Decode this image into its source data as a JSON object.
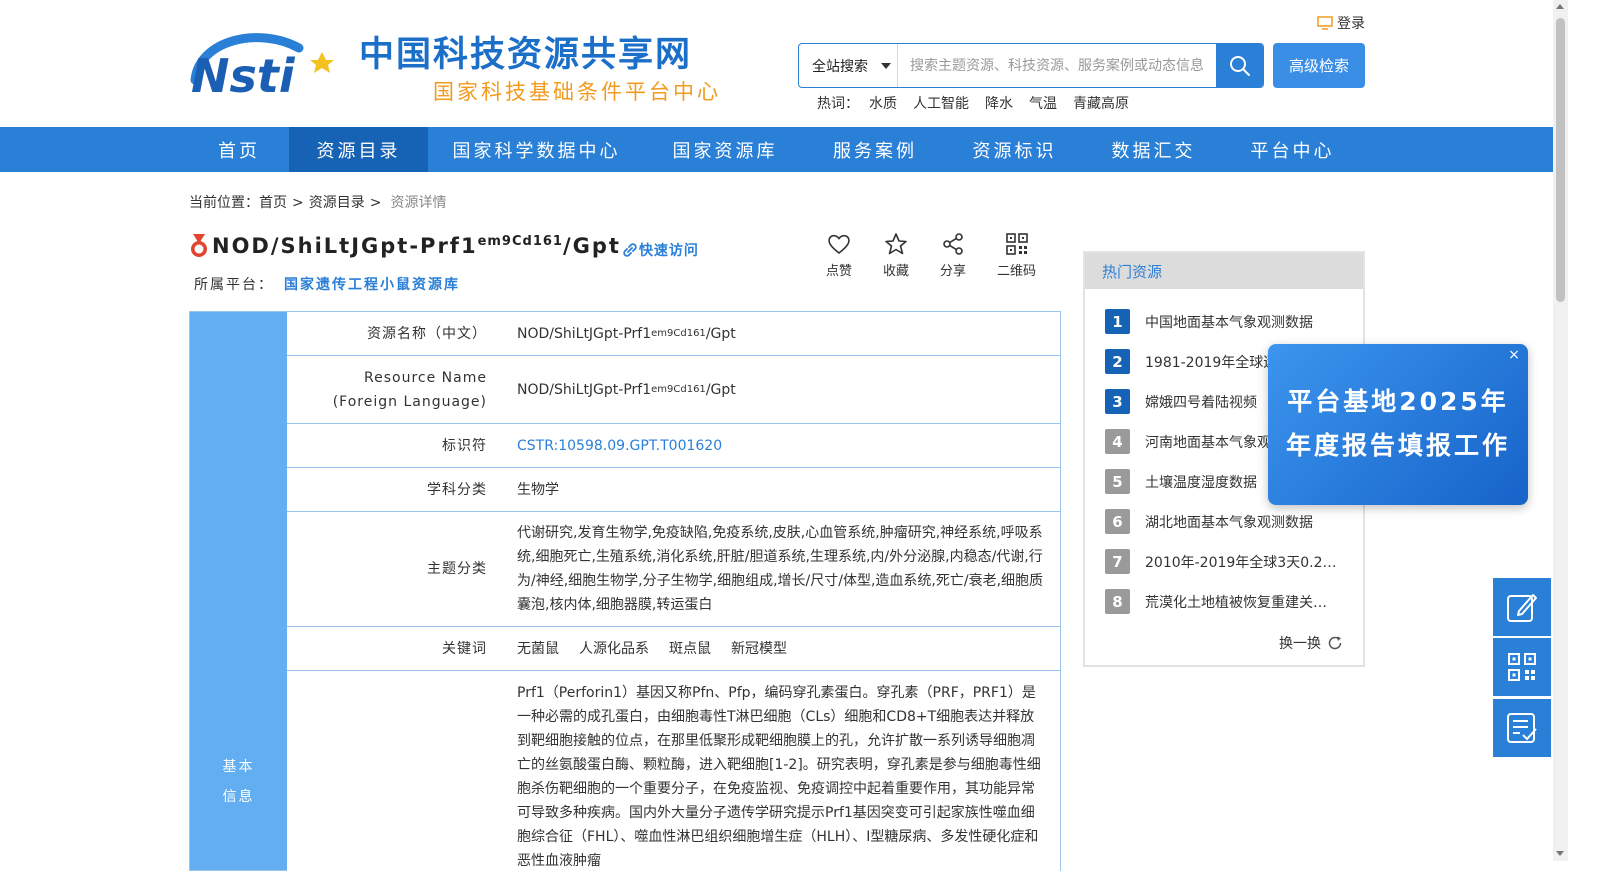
{
  "header": {
    "site_title": "中国科技资源共享网",
    "site_subtitle": "国家科技基础条件平台中心",
    "login": "登录",
    "search_scope": "全站搜索",
    "search_placeholder": "搜索主题资源、科技资源、服务案例或动态信息",
    "advanced_search": "高级检索",
    "hot_label": "热词：",
    "hot_words": [
      "水质",
      "人工智能",
      "降水",
      "气温",
      "青藏高原"
    ]
  },
  "nav": [
    "首页",
    "资源目录",
    "国家科学数据中心",
    "国家资源库",
    "服务案例",
    "资源标识",
    "数据汇交",
    "平台中心"
  ],
  "breadcrumb": {
    "label": "当前位置：",
    "home": "首页",
    "catalog": "资源目录",
    "current": "资源详情",
    "sep": ">"
  },
  "resource": {
    "name_pre": "NOD/ShiLtJGpt-Prf1",
    "name_sup": "em9Cd161",
    "name_post": "/Gpt",
    "quick_access": "快速访问",
    "platform_label": "所属平台：",
    "platform_value": "国家遗传工程小鼠资源库"
  },
  "actions": [
    "点赞",
    "收藏",
    "分享",
    "二维码"
  ],
  "info": {
    "side_label_1": "基本",
    "side_label_2": "信息",
    "rows": {
      "name_cn": {
        "k": "资源名称（中文）",
        "pre": "NOD/ShiLtJGpt-Prf1",
        "sup": "em9Cd161",
        "post": "/Gpt"
      },
      "name_en": {
        "k1": "Resource Name",
        "k2": "(Foreign Language)",
        "pre": "NOD/ShiLtJGpt-Prf1",
        "sup": "em9Cd161",
        "post": "/Gpt"
      },
      "identifier": {
        "k": "标识符",
        "v": "CSTR:10598.09.GPT.T001620"
      },
      "subject": {
        "k": "学科分类",
        "v": "生物学"
      },
      "topic": {
        "k": "主题分类",
        "v": "代谢研究,发育生物学,免疫缺陷,免疫系统,皮肤,心血管系统,肿瘤研究,神经系统,呼吸系统,细胞死亡,生殖系统,消化系统,肝脏/胆道系统,生理系统,内/外分泌腺,内稳态/代谢,行为/神经,细胞生物学,分子生物学,细胞组成,增长/尺寸/体型,造血系统,死亡/衰老,细胞质囊泡,核内体,细胞器膜,转运蛋白"
      },
      "keywords": {
        "k": "关键词",
        "v": [
          "无菌鼠",
          "人源化品系",
          "斑点鼠",
          "新冠模型"
        ]
      },
      "description": {
        "v": "Prf1（Perforin1）基因又称Pfn、Pfp，编码穿孔素蛋白。穿孔素（PRF，PRF1）是一种必需的成孔蛋白，由细胞毒性T淋巴细胞（CLs）细胞和CD8+T细胞表达并释放到靶细胞接触的位点，在那里低聚形成靶细胞膜上的孔，允许扩散一系列诱导细胞凋亡的丝氨酸蛋白酶、颗粒酶，进入靶细胞[1-2]。研究表明，穿孔素是参与细胞毒性细胞杀伤靶细胞的一个重要分子，在免疫监视、免疫调控中起着重要作用，其功能异常可导致多种疾病。国内外大量分子遗传学研究提示Prf1基因突变可引起家族性噬血细胞综合征（FHL）、噬血性淋巴组织细胞增生症（HLH）、I型糖尿病、多发性硬化症和恶性血液肿瘤"
      }
    }
  },
  "hot": {
    "title": "热门资源",
    "items": [
      "中国地面基本气象观测数据",
      "1981-2019年全球逐日",
      "嫦娥四号着陆视频",
      "河南地面基本气象观测数据",
      "土壤温度湿度数据",
      "湖北地面基本气象观测数据",
      "2010年-2019年全球3天0.25°…",
      "荒漠化土地植被恢复重建关键…"
    ],
    "ranks": [
      "1",
      "2",
      "3",
      "4",
      "5",
      "6",
      "7",
      "8"
    ],
    "refresh": "换一换"
  },
  "popup": {
    "close": "×",
    "line1": "平台基地2025年",
    "line2": "年度报告填报工作"
  },
  "colors": {
    "primary": "#2a7fd6",
    "nav_active": "#1662b4",
    "accent_orange": "#f29b1f",
    "side_blue": "#62aef0"
  },
  "icons": {
    "login": "monitor-icon",
    "search": "search-icon",
    "quick": "link-icon",
    "actions": [
      "heart-icon",
      "star-icon",
      "share-icon",
      "qrcode-icon"
    ],
    "tools": [
      "edit-icon",
      "qrcode-icon",
      "checklist-icon"
    ],
    "refresh": "refresh-icon"
  }
}
